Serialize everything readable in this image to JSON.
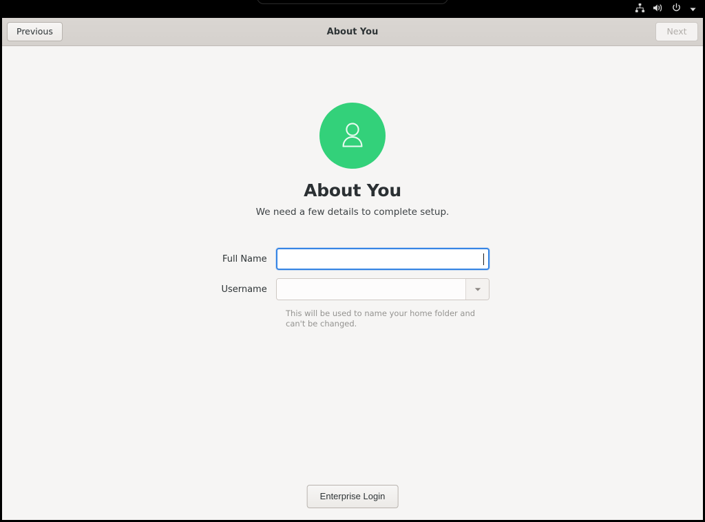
{
  "topbar": {
    "icons": [
      {
        "name": "network-wired-icon",
        "label": "Wired Network"
      },
      {
        "name": "volume-icon",
        "label": "Volume"
      },
      {
        "name": "power-icon",
        "label": "Power"
      },
      {
        "name": "chevron-down-icon",
        "label": "System Menu"
      }
    ]
  },
  "headerbar": {
    "previous_label": "Previous",
    "title": "About You",
    "next_label": "Next",
    "next_enabled": false
  },
  "page": {
    "avatar_icon": "person-avatar-icon",
    "title": "About You",
    "subtitle": "We need a few details to complete setup."
  },
  "form": {
    "fields": [
      {
        "name": "full-name",
        "label": "Full Name",
        "value": "",
        "placeholder": "",
        "focused": true,
        "type": "entry"
      },
      {
        "name": "username",
        "label": "Username",
        "value": "",
        "placeholder": "",
        "focused": false,
        "type": "combo"
      }
    ],
    "username_helper": "This will be used to name your home folder and can't be changed."
  },
  "footer": {
    "enterprise_login_label": "Enterprise Login"
  },
  "colors": {
    "accent_green": "#33d17a",
    "focus_blue": "#3584e4",
    "headerbar": "#d5d1cd",
    "page_background": "#f6f5f4",
    "topbar": "#000000",
    "helper_text": "#949390"
  }
}
